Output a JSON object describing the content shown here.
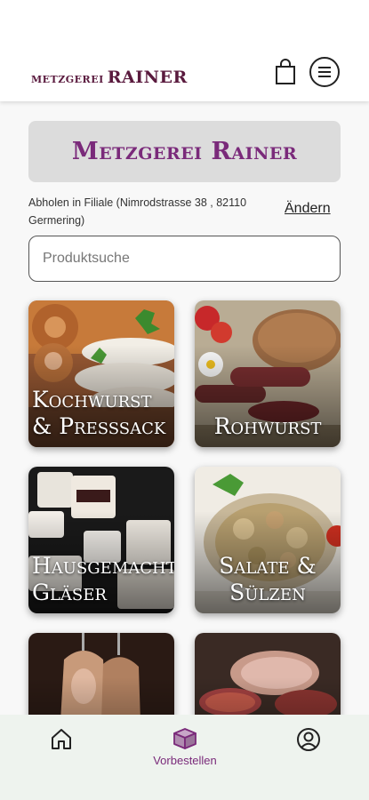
{
  "header": {
    "logo_small": "METZGEREI",
    "logo_big": "RAINER",
    "icons": {
      "cart": "shopping-bag-icon",
      "menu": "menu-icon"
    }
  },
  "banner": {
    "title": "Metzgerei Rainer"
  },
  "pickup": {
    "text": "Abholen in Filiale (Nimrodstrasse 38 , 82110 Germering)",
    "change_label": "Ändern"
  },
  "search": {
    "placeholder": "Produktsuche"
  },
  "categories": [
    {
      "label": "Kochwurst & Preßsack"
    },
    {
      "label": "Rohwurst"
    },
    {
      "label": "Hausgemachte Gläser"
    },
    {
      "label": "Salate & Sülzen"
    },
    {
      "label": ""
    },
    {
      "label": ""
    }
  ],
  "bottom_nav": {
    "home_icon": "home-icon",
    "order_label": "Vorbestellen",
    "order_icon": "box-icon",
    "account_icon": "user-icon"
  },
  "colors": {
    "brand": "#5a1a3e",
    "accent": "#7a2a7a",
    "banner_bg": "#dcdcdc",
    "nav_bg": "#eef3ee"
  }
}
